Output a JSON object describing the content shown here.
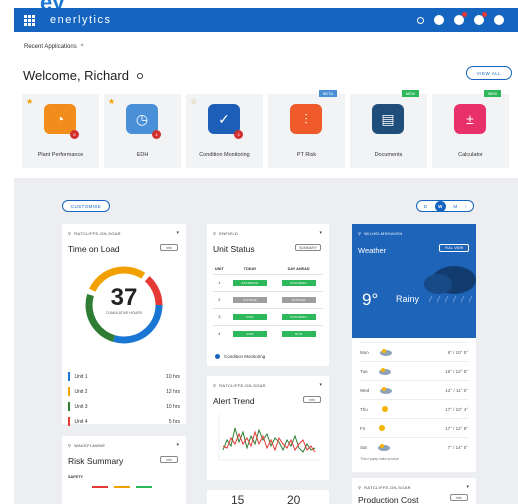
{
  "header": {
    "brand": "enerlytics"
  },
  "recent": {
    "label": "Recent Applications"
  },
  "welcome": {
    "text": "Welcome, Richard",
    "view_all": "VIEW ALL"
  },
  "apps": [
    {
      "label": "Plant Performance",
      "color": "#f28c1b",
      "star": true,
      "badge": "6",
      "tag": ""
    },
    {
      "label": "EDH",
      "color": "#4a90d9",
      "star": true,
      "badge": "4",
      "tag": ""
    },
    {
      "label": "Condition Monitoring",
      "color": "#1d5fb8",
      "star": false,
      "badge": "3",
      "tag": ""
    },
    {
      "label": "PT Risk",
      "color": "#ef5a2a",
      "star": false,
      "badge": "",
      "tag": "BETA"
    },
    {
      "label": "Documents",
      "color": "#1e4e79",
      "star": false,
      "badge": "",
      "tag": "NEW"
    },
    {
      "label": "Calculator",
      "color": "#e8316a",
      "star": false,
      "badge": "",
      "tag": "NEW"
    }
  ],
  "dashboard": {
    "customise": "CUSTOMISE",
    "range": {
      "d": "D",
      "w": "W",
      "m": "M"
    }
  },
  "time_on_load": {
    "location": "RATCLIFFE-ON-SOAR",
    "title": "Time on Load",
    "info": "info",
    "total": "37",
    "total_caption": "CUMULATIVE HOURS",
    "units": [
      {
        "name": "Unit 1",
        "hours": "10 hrs",
        "color": "#1976d2"
      },
      {
        "name": "Unit 2",
        "hours": "12 hrs",
        "color": "#f2a000"
      },
      {
        "name": "Unit 3",
        "hours": "10 hrs",
        "color": "#2e7d32"
      },
      {
        "name": "Unit 4",
        "hours": "5 hrs",
        "color": "#e53935"
      }
    ],
    "source": "Plant Performance"
  },
  "unit_status": {
    "location": "ENFIELD",
    "title": "Unit Status",
    "filter": "SUMMARY",
    "columns": {
      "unit": "UNIT",
      "today": "TODAY",
      "ahead": "DAY AHEAD"
    },
    "rows": [
      {
        "unit": "1",
        "today": "STANDING",
        "today_color": "#2eb85c",
        "ahead": "STANDING",
        "ahead_color": "#2eb85c"
      },
      {
        "unit": "2",
        "today": "OUTAGE",
        "today_color": "#9e9e9e",
        "ahead": "OUTAGE",
        "ahead_color": "#9e9e9e"
      },
      {
        "unit": "3",
        "today": "RUN",
        "today_color": "#2eb85c",
        "ahead": "STANDING",
        "ahead_color": "#2eb85c"
      },
      {
        "unit": "4",
        "today": "RUN",
        "today_color": "#2eb85c",
        "ahead": "RUN",
        "ahead_color": "#2eb85c"
      }
    ],
    "source": "Condition Monitoring"
  },
  "alert_trend": {
    "location": "RATCLIFFE-ON-SOAR",
    "title": "Alert Trend",
    "info": "info"
  },
  "weather": {
    "location": "WILHELMSHAVEN",
    "title": "Weather",
    "button": "FULL VIEW",
    "temp": "9°",
    "condition": "Rainy",
    "forecast": [
      {
        "day": "Mon",
        "temps": "9° / 10°  5°",
        "icon": "cloud"
      },
      {
        "day": "Tue",
        "temps": "15° / 12°  5°",
        "icon": "cloud"
      },
      {
        "day": "Wed",
        "temps": "12° / 11°  5°",
        "icon": "cloud"
      },
      {
        "day": "Thu",
        "temps": "17° / 10°  4°",
        "icon": "sun"
      },
      {
        "day": "Fri",
        "temps": "17° / 12°  8°",
        "icon": "sun"
      },
      {
        "day": "Sat",
        "temps": "7° / 14°  5°",
        "icon": "cloud"
      }
    ],
    "source": "Third party data source"
  },
  "risk_summary": {
    "location": "WAKEFLAWNE",
    "title": "Risk Summary",
    "info": "info",
    "sub": "SAFETY"
  },
  "bottom_numbers": {
    "a": "15",
    "b": "20"
  },
  "production_cost": {
    "location": "RATCLIFFE-ON-SOAR",
    "title": "Production Cost",
    "info": "info"
  }
}
